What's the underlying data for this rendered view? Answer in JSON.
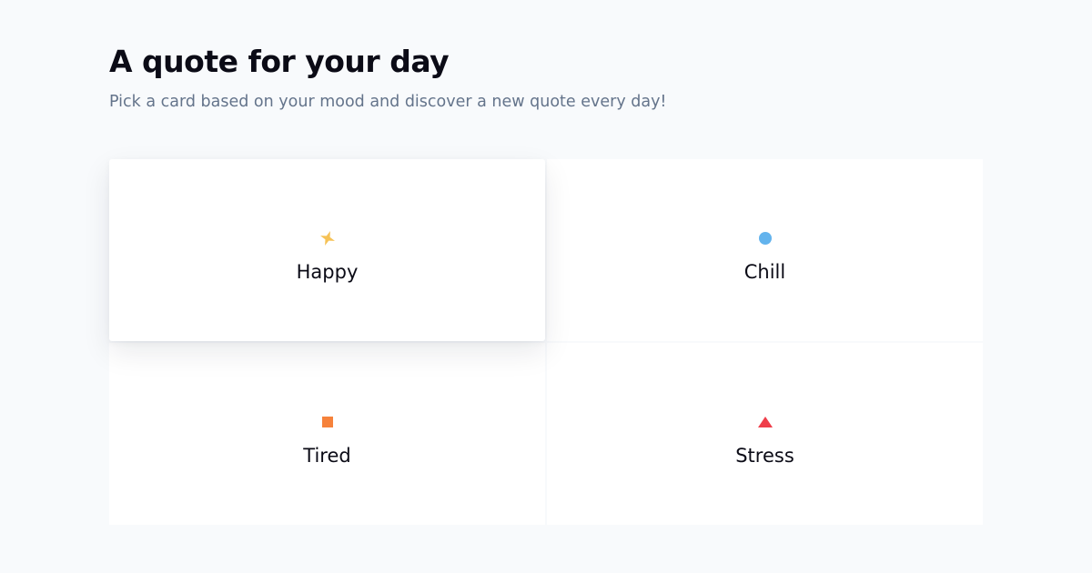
{
  "header": {
    "title": "A quote for your day",
    "subtitle": "Pick a card based on your mood and discover a new quote every day!"
  },
  "moods": [
    {
      "label": "Happy",
      "icon": "sparkle-icon",
      "color": "#f6c256",
      "active": true
    },
    {
      "label": "Chill",
      "icon": "circle-icon",
      "color": "#63b3ed",
      "active": false
    },
    {
      "label": "Tired",
      "icon": "square-icon",
      "color": "#f6823b",
      "active": false
    },
    {
      "label": "Stress",
      "icon": "triangle-icon",
      "color": "#ef3e4a",
      "active": false
    }
  ]
}
